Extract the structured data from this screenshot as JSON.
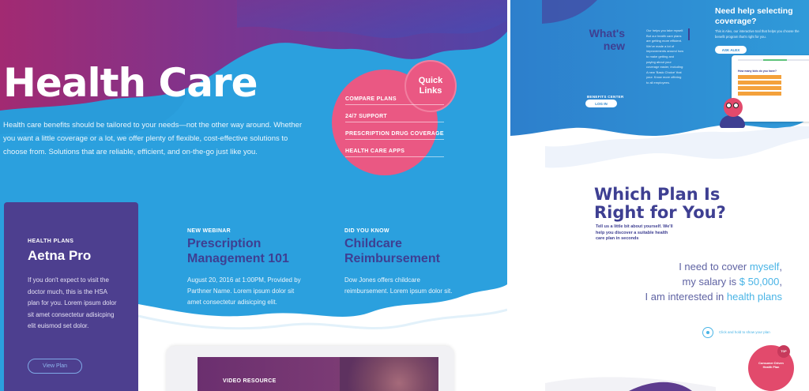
{
  "hero": {
    "title": "Health Care",
    "description": "Health care benefits should be tailored to your needs—not the other way around. Whether you want a little coverage or a lot, we offer plenty of flexible, cost-effective solutions to choose from. Solutions that are reliable, efficient, and on-the-go just like you."
  },
  "quick_links": {
    "badge_line1": "Quick",
    "badge_line2": "Links",
    "items": [
      "COMPARE PLANS",
      "24/7 SUPPORT",
      "PRESCRIPTION DRUG  COVERAGE",
      "HEALTH CARE APPS"
    ]
  },
  "plan_card": {
    "kicker": "HEALTH PLANS",
    "name": "Aetna Pro",
    "description": "If you don't expect to visit the doctor much, this is the HSA plan for you.  Lorem ipsum dolor sit amet consectetur adisicping elit euismod set dolor.",
    "button_label": "View Plan"
  },
  "articles": [
    {
      "kicker": "NEW WEBINAR",
      "title_line1": "Prescription",
      "title_line2": "Management 101",
      "body": "August 20, 2016 at 1:00PM, Provided by Parthner Name. Lorem ipsum dolor sit amet consectetur adisicping elit."
    },
    {
      "kicker": "DID YOU KNOW",
      "title_line1": "Childcare",
      "title_line2": "Reimbursement",
      "body": "Dow Jones offers childcare reimbursement. Lorem ipsum dolor sit."
    }
  ],
  "video": {
    "label": "VIDEO RESOURCE"
  },
  "whats_new": {
    "title_line1": "What's",
    "title_line2": "new",
    "body": "Our helps you take myself. But our health care plans are getting more efficient. We've made a lot of improvements around how to make getting and paying about your coverage easier, including: A new 'Basic Choice' that your. Know more offering to all employees.",
    "benefits_label": "BENEFITS CENTER",
    "login_label": "LOG IN"
  },
  "help": {
    "title_line1": "Need help selecting",
    "title_line2": "coverage?",
    "body": "This is Alex, our interactive tool that helps you choose the benefit program that's right for you.",
    "button_label": "ASK ALEX",
    "question": "How many kids do you have?"
  },
  "plan_finder": {
    "title_line1": "Which Plan Is",
    "title_line2": "Right for You?",
    "subtitle": "Tell us a little bit about yourself. We'll help you discover a suitable health care plan in seconds",
    "s1_prefix": "I need to cover ",
    "s1_value": "myself",
    "s1_suffix": ",",
    "s2_prefix": "my salary is ",
    "s2_value": "$ 50,000",
    "s2_suffix": ",",
    "s3_prefix": "I am interested in ",
    "s3_value": "health plans",
    "next_label": "Click and hold to show your plan",
    "result_text": "Consumer Driven Health Plan",
    "result_badge": "TOP"
  },
  "colors": {
    "blue": "#2ba0de",
    "purple": "#4d3f8f",
    "navy_text": "#3e3f92",
    "pink": "#ea5883",
    "highlight": "#49b4e6",
    "lavender": "#c7cef0"
  }
}
